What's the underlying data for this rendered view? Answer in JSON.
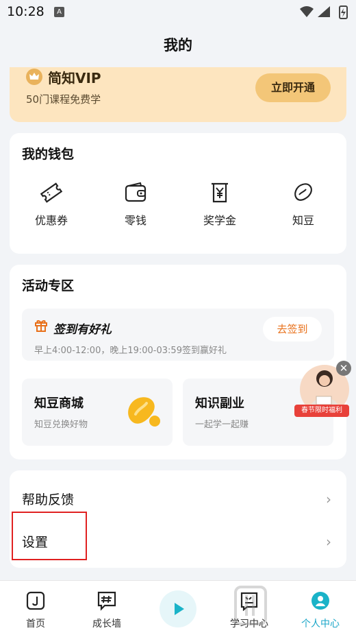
{
  "status": {
    "time": "10:28",
    "notif": "A"
  },
  "nav": {
    "title": "我的"
  },
  "vip": {
    "name": "简知VIP",
    "desc": "50门课程免费学",
    "button": "立即开通"
  },
  "wallet": {
    "title": "我的钱包",
    "items": [
      {
        "label": "优惠券",
        "icon": "ticket-icon"
      },
      {
        "label": "零钱",
        "icon": "wallet-icon"
      },
      {
        "label": "奖学金",
        "icon": "scholarship-icon"
      },
      {
        "label": "知豆",
        "icon": "bean-icon"
      }
    ]
  },
  "activity": {
    "title": "活动专区",
    "checkin": {
      "title": "签到有好礼",
      "desc": "早上4:00-12:00，晚上19:00-03:59签到赢好礼",
      "button": "去签到"
    },
    "promos": [
      {
        "title": "知豆商城",
        "desc": "知豆兑换好物"
      },
      {
        "title": "知识副业",
        "desc": "一起学一起赚"
      }
    ],
    "float_ad": {
      "tag": "春节限时福利",
      "close": "✕"
    }
  },
  "settings_list": [
    {
      "label": "帮助反馈",
      "chevron": "›"
    },
    {
      "label": "设置",
      "chevron": "›"
    }
  ],
  "tabbar": {
    "tabs": [
      {
        "label": "首页",
        "icon": "home-icon"
      },
      {
        "label": "成长墙",
        "icon": "hashtag-icon"
      },
      {
        "label": "学习中心",
        "icon": "study-icon"
      },
      {
        "label": "个人中心",
        "icon": "profile-icon"
      }
    ],
    "active_color": "#1aa6c8"
  },
  "colors": {
    "vip_bg": "#fde5bf",
    "vip_button": "#f3c678",
    "checkin_accent": "#e8701a",
    "highlight": "#e02020"
  }
}
